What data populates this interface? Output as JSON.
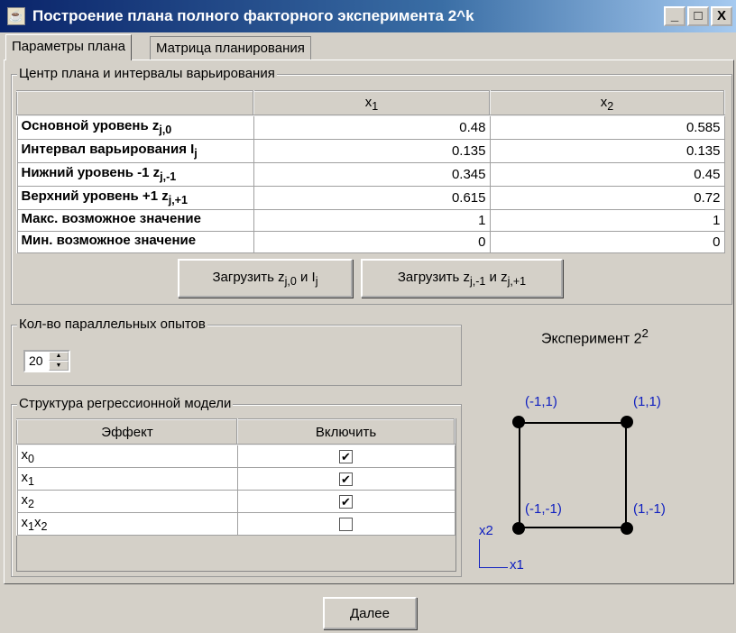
{
  "window": {
    "title": "Построение плана полного факторного эксперимента 2^k",
    "minimize": "_",
    "maximize": "□",
    "close": "X",
    "icon": "java-icon"
  },
  "tabs": [
    {
      "label": "Параметры плана",
      "active": true
    },
    {
      "label": "Матрица планирования",
      "active": false
    }
  ],
  "plan_center": {
    "title": "Центр плана и интервалы варьирования",
    "headers": [
      "",
      "x",
      "x"
    ],
    "header_subs": [
      "",
      "1",
      "2"
    ],
    "rows": [
      {
        "label": "Основной уровень z",
        "sub": "j,0",
        "x1": "0.48",
        "x2": "0.585"
      },
      {
        "label": "Интервал варьирования I",
        "sub": "j",
        "x1": "0.135",
        "x2": "0.135"
      },
      {
        "label": "Нижний уровень -1 z",
        "sub": "j,-1",
        "x1": "0.345",
        "x2": "0.45"
      },
      {
        "label": "Верхний уровень +1 z",
        "sub": "j,+1",
        "x1": "0.615",
        "x2": "0.72"
      },
      {
        "label": "Макс. возможное значение",
        "sub": "",
        "x1": "1",
        "x2": "1"
      },
      {
        "label": "Мин. возможное значение",
        "sub": "",
        "x1": "0",
        "x2": "0"
      }
    ],
    "load_btn1": {
      "a": "Загрузить z",
      "a_sub": "j,0",
      "b": " и I",
      "b_sub": "j"
    },
    "load_btn2": {
      "a": "Загрузить z",
      "a_sub": "j,-1",
      "b": " и z",
      "b_sub": "j,+1"
    }
  },
  "parallel": {
    "title": "Кол-во параллельных опытов",
    "value": "20"
  },
  "regression": {
    "title": "Структура регрессионной модели",
    "headers": [
      "Эффект",
      "Включить"
    ],
    "rows": [
      {
        "effect": "x",
        "sub": "0",
        "effect2": "",
        "sub2": "",
        "checked": true
      },
      {
        "effect": "x",
        "sub": "1",
        "effect2": "",
        "sub2": "",
        "checked": true
      },
      {
        "effect": "x",
        "sub": "2",
        "effect2": "",
        "sub2": "",
        "checked": true
      },
      {
        "effect": "x",
        "sub": "1",
        "effect2": "x",
        "sub2": "2",
        "checked": false
      }
    ]
  },
  "experiment": {
    "title": "Эксперимент 2",
    "power": "2",
    "points": [
      "(-1,1)",
      "(1,1)",
      "(-1,-1)",
      "(1,-1)"
    ],
    "axis_x": "x1",
    "axis_y": "x2"
  },
  "footer": {
    "next": "Далее"
  }
}
